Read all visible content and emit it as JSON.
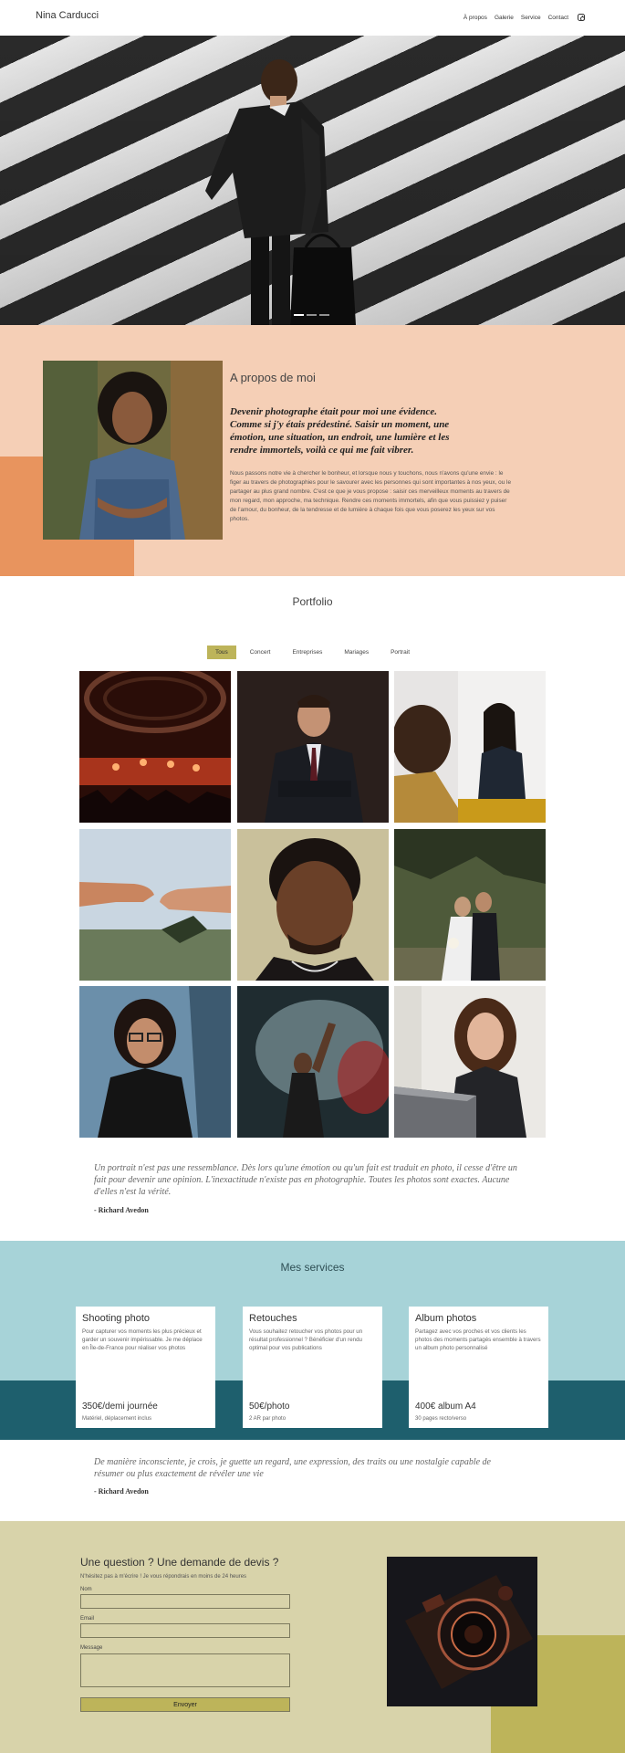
{
  "header": {
    "brand": "Nina Carducci",
    "nav": [
      "À propos",
      "Galerie",
      "Service",
      "Contact"
    ],
    "social_icon": "instagram-icon"
  },
  "hero": {
    "slide_count": 3,
    "active_slide": 1
  },
  "about": {
    "title": "A propos de moi",
    "quote": "Devenir photographe était pour moi une évidence. Comme si j'y étais prédestiné. Saisir un moment, une émotion, une situation, un endroit, une lumière et les rendre immortels, voilà ce qui me fait vibrer.",
    "text": "Nous passons notre vie à chercher le bonheur, et lorsque nous y touchons, nous n'avons qu'une envie : le figer au travers de photographies pour le savourer avec les personnes qui sont importantes à nos yeux, ou le partager au plus grand nombre. C'est ce que je vous propose : saisir ces merveilleux moments au travers de mon regard, mon approche, ma technique. Rendre ces moments immortels, afin que vous puissiez y puiser de l'amour, du bonheur, de la tendresse et de lumière à chaque fois que vous poserez les yeux sur vos photos."
  },
  "portfolio": {
    "title": "Portfolio",
    "filters": [
      "Tous",
      "Concert",
      "Entreprises",
      "Mariages",
      "Portrait"
    ],
    "active_filter": "Tous"
  },
  "quote1": {
    "text": "Un portrait n'est pas une ressemblance. Dès lors qu'une émotion ou qu'un fait est traduit en photo, il cesse d'être un fait pour devenir une opinion. L'inexactitude n'existe pas en photographie. Toutes les photos sont exactes. Aucune d'elles n'est la vérité.",
    "author": "- Richard Avedon"
  },
  "services": {
    "title": "Mes services",
    "cards": [
      {
        "title": "Shooting photo",
        "desc": "Pour capturer vos moments les plus précieux et garder un souvenir impérissable. Je me déplace en Île-de-France pour réaliser vos photos",
        "price": "350€/demi journée",
        "note": "Matériel, déplacement inclus"
      },
      {
        "title": "Retouches",
        "desc": "Vous souhaitez retoucher vos photos pour un résultat professionnel ? Bénéficier d'un rendu optimal pour vos publications",
        "price": "50€/photo",
        "note": "2 AR par photo"
      },
      {
        "title": "Album photos",
        "desc": "Partagez avec vos proches et vos clients les photos des moments partagés ensemble à travers un album photo personnalisé",
        "price": "400€ album A4",
        "note": "30 pages recto/verso"
      }
    ]
  },
  "quote2": {
    "text": "De manière inconsciente, je crois, je guette un regard, une expression, des traits ou une nostalgie capable de résumer ou plus exactement de révéler une vie",
    "author": "- Richard Avedon"
  },
  "contact": {
    "title": "Une question ? Une demande de devis ?",
    "subtitle": "N'hésitez pas à m'écrire ! Je vous répondrais en moins de 24 heures",
    "name_label": "Nom",
    "email_label": "Email",
    "message_label": "Message",
    "name_value": "",
    "email_value": "",
    "message_value": "",
    "submit_label": "Envoyer"
  }
}
